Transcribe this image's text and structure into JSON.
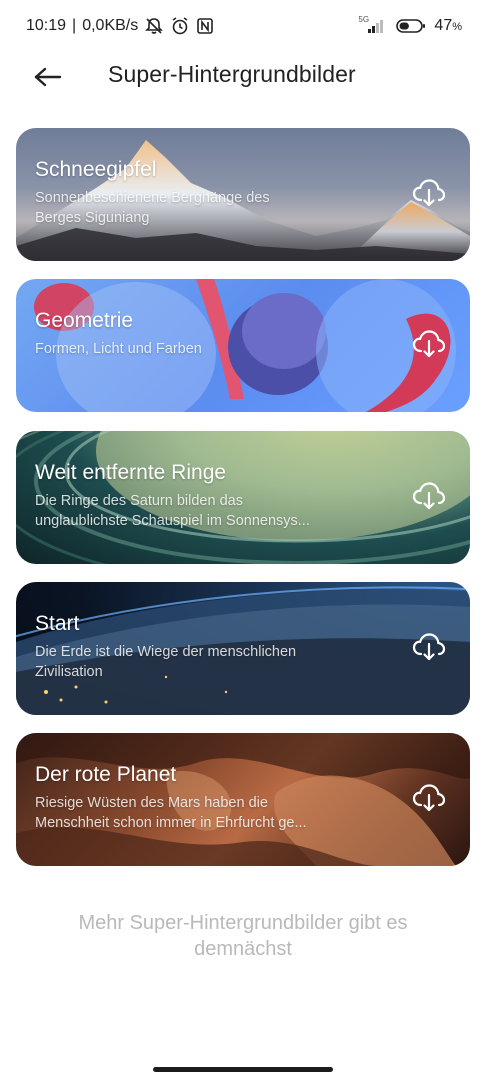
{
  "status_bar": {
    "time": "10:19",
    "network_speed": "0,0KB/s",
    "network_type": "5G",
    "battery_percent": "47",
    "battery_unit": "%",
    "battery_level": 0.47,
    "icons": [
      "mute-icon",
      "alarm-icon",
      "nfc-icon",
      "signal-icon",
      "battery-icon"
    ]
  },
  "header": {
    "title": "Super-Hintergrundbilder",
    "back_icon": "arrow-left-icon"
  },
  "wallpapers": [
    {
      "title": "Schneegipfel",
      "desc_line1": "Sonnenbeschienene Berghänge des",
      "desc_line2": "Berges Siguniang",
      "icon": "cloud-download-icon"
    },
    {
      "title": "Geometrie",
      "desc_line1": "Formen, Licht und Farben",
      "desc_line2": "",
      "icon": "cloud-download-icon"
    },
    {
      "title": "Weit entfernte Ringe",
      "desc_line1": "Die Ringe des Saturn bilden das",
      "desc_line2": "unglaublichste Schauspiel im Sonnensys...",
      "icon": "cloud-download-icon"
    },
    {
      "title": "Start",
      "desc_line1": "Die Erde ist die Wiege der menschlichen",
      "desc_line2": "Zivilisation",
      "icon": "cloud-download-icon"
    },
    {
      "title": "Der rote Planet",
      "desc_line1": "Riesige Wüsten des Mars haben die",
      "desc_line2": "Menschheit schon immer in Ehrfurcht ge...",
      "icon": "cloud-download-icon"
    }
  ],
  "footer": {
    "note": "Mehr Super-Hintergrundbilder gibt es demnächst"
  }
}
